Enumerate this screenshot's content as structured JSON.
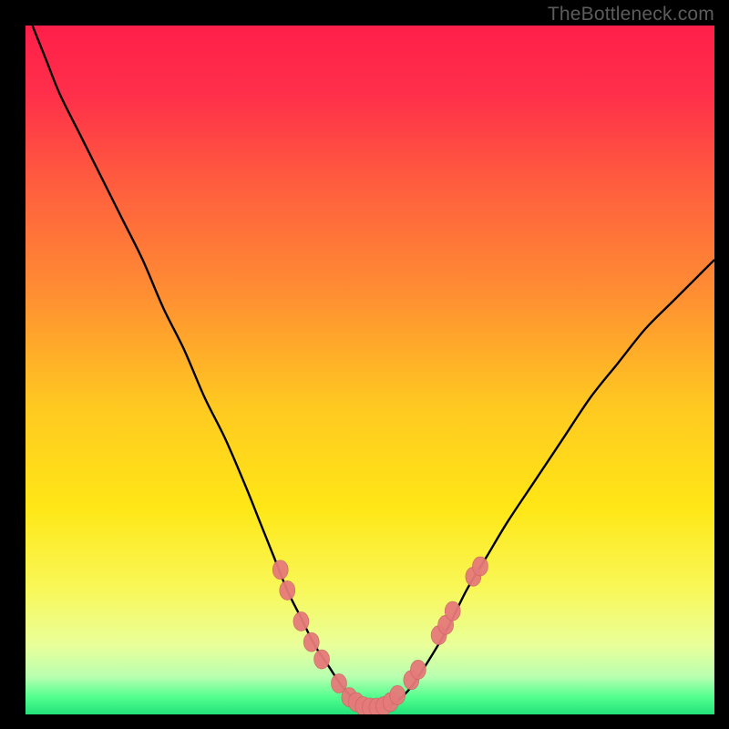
{
  "watermark": "TheBottleneck.com",
  "colors": {
    "frame": "#000000",
    "gradient_stops": [
      {
        "offset": 0.0,
        "color": "#ff1f4a"
      },
      {
        "offset": 0.1,
        "color": "#ff2f4a"
      },
      {
        "offset": 0.22,
        "color": "#ff5a3f"
      },
      {
        "offset": 0.38,
        "color": "#ff8b33"
      },
      {
        "offset": 0.55,
        "color": "#ffc821"
      },
      {
        "offset": 0.7,
        "color": "#ffe716"
      },
      {
        "offset": 0.82,
        "color": "#f8f85a"
      },
      {
        "offset": 0.9,
        "color": "#e9ff9a"
      },
      {
        "offset": 0.945,
        "color": "#b9ffb0"
      },
      {
        "offset": 0.975,
        "color": "#52ff8e"
      },
      {
        "offset": 1.0,
        "color": "#22e27a"
      }
    ],
    "curve": "#000000",
    "marker_fill": "#e67a7a",
    "marker_stroke": "#c86060"
  },
  "chart_data": {
    "type": "line",
    "title": "",
    "xlabel": "",
    "ylabel": "",
    "xlim": [
      0,
      100
    ],
    "ylim": [
      0,
      100
    ],
    "grid": false,
    "legend": false,
    "series": [
      {
        "name": "bottleneck-curve",
        "x": [
          1,
          3,
          5,
          8,
          11,
          14,
          17,
          20,
          23,
          26,
          29,
          32,
          34,
          36,
          38,
          40,
          42,
          44,
          46,
          48,
          50,
          52,
          54,
          56,
          58,
          61,
          64,
          67,
          70,
          74,
          78,
          82,
          86,
          90,
          94,
          98,
          100
        ],
        "y": [
          100,
          95,
          90,
          84,
          78,
          72,
          66,
          59,
          53,
          46,
          40,
          33,
          28,
          23,
          18,
          14,
          10,
          7,
          4,
          2,
          1,
          1,
          2,
          4,
          7,
          12,
          18,
          23,
          28,
          34,
          40,
          46,
          51,
          56,
          60,
          64,
          66
        ]
      }
    ],
    "markers": {
      "name": "highlight-points",
      "points": [
        {
          "x": 37.0,
          "y": 21.0
        },
        {
          "x": 38.0,
          "y": 18.0
        },
        {
          "x": 40.0,
          "y": 13.5
        },
        {
          "x": 41.5,
          "y": 10.5
        },
        {
          "x": 43.0,
          "y": 8.0
        },
        {
          "x": 45.5,
          "y": 4.5
        },
        {
          "x": 47.0,
          "y": 2.5
        },
        {
          "x": 48.0,
          "y": 1.8
        },
        {
          "x": 49.0,
          "y": 1.2
        },
        {
          "x": 50.0,
          "y": 1.0
        },
        {
          "x": 51.0,
          "y": 1.0
        },
        {
          "x": 52.0,
          "y": 1.2
        },
        {
          "x": 53.0,
          "y": 1.8
        },
        {
          "x": 54.0,
          "y": 2.8
        },
        {
          "x": 56.0,
          "y": 5.0
        },
        {
          "x": 57.0,
          "y": 6.5
        },
        {
          "x": 60.0,
          "y": 11.5
        },
        {
          "x": 61.0,
          "y": 13.0
        },
        {
          "x": 62.0,
          "y": 15.0
        },
        {
          "x": 65.0,
          "y": 20.0
        },
        {
          "x": 66.0,
          "y": 21.5
        }
      ]
    },
    "annotations": []
  }
}
